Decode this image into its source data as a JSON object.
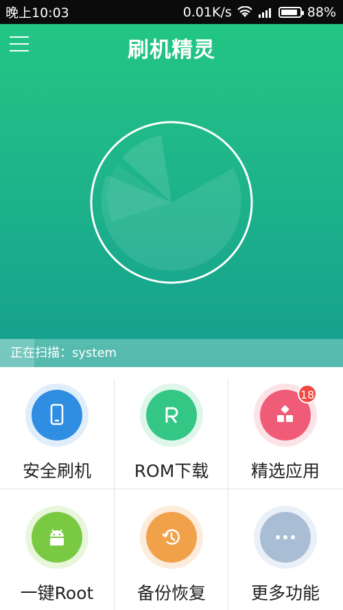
{
  "status_bar": {
    "time": "晚上10:03",
    "network_speed": "0.01K/s",
    "battery_percent": "88%",
    "battery_level": 0.88
  },
  "header": {
    "title": "刷机精灵",
    "menu_icon": "hamburger-menu-icon"
  },
  "scan": {
    "label": "正在扫描：system",
    "progress": 0.1
  },
  "colors": {
    "header_top": "#23c684",
    "header_bottom": "#149f8f",
    "blue": "#2f8de2",
    "green": "#33c684",
    "pink": "#f05b78",
    "lime": "#7ac943",
    "orange": "#f2a14b",
    "slate": "#a9bdd4"
  },
  "features": [
    {
      "label": "安全刷机",
      "icon": "phone-icon"
    },
    {
      "label": "ROM下载",
      "icon": "rom-r-icon"
    },
    {
      "label": "精选应用",
      "icon": "apps-grid-icon",
      "badge": "18"
    },
    {
      "label": "一键Root",
      "icon": "android-icon"
    },
    {
      "label": "备份恢复",
      "icon": "restore-clock-icon"
    },
    {
      "label": "更多功能",
      "icon": "more-dots-icon"
    }
  ]
}
